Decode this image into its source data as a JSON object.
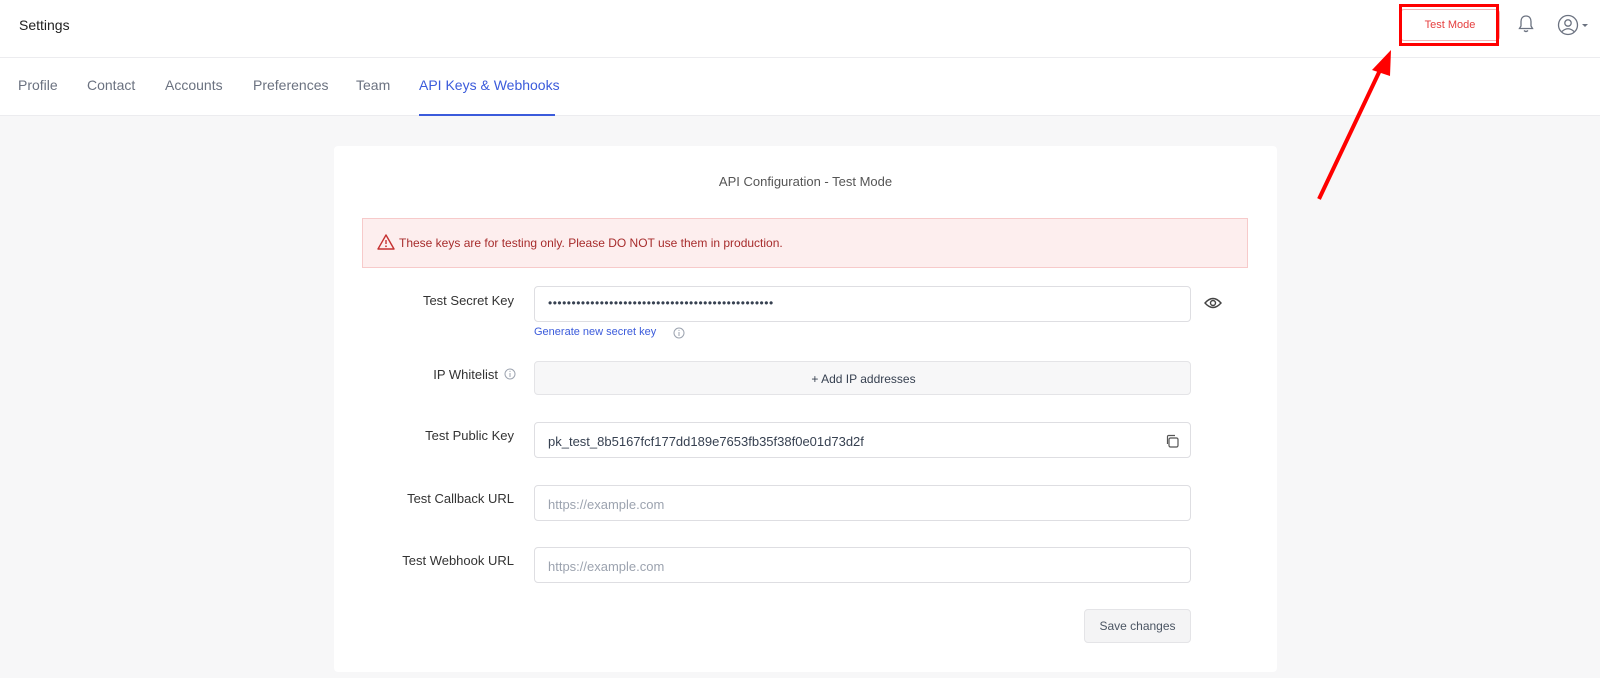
{
  "app": {
    "title": "Settings"
  },
  "header": {
    "test_mode_label": "Test Mode"
  },
  "tabs": [
    {
      "label": "Profile"
    },
    {
      "label": "Contact"
    },
    {
      "label": "Accounts"
    },
    {
      "label": "Preferences"
    },
    {
      "label": "Team"
    },
    {
      "label": "API Keys & Webhooks",
      "active": true
    }
  ],
  "config": {
    "title": "API Configuration - Test Mode",
    "alert": "These keys are for testing only. Please DO NOT use them in production.",
    "secret_key_label": "Test Secret Key",
    "secret_key_value": "••••••••••••••••••••••••••••••••••••••••••••••••",
    "generate_link": "Generate new secret key",
    "ip_whitelist_label": "IP Whitelist",
    "add_ip_label": "+ Add IP addresses",
    "public_key_label": "Test Public Key",
    "public_key_value": "pk_test_8b5167fcf177dd189e7653fb35f38f0e01d73d2f",
    "callback_label": "Test Callback URL",
    "callback_placeholder": "https://example.com",
    "webhook_label": "Test Webhook URL",
    "webhook_placeholder": "https://example.com",
    "save_label": "Save changes"
  },
  "colors": {
    "accent": "#3b5bdb",
    "danger": "#e53e3e",
    "annotation": "#ff0000"
  }
}
